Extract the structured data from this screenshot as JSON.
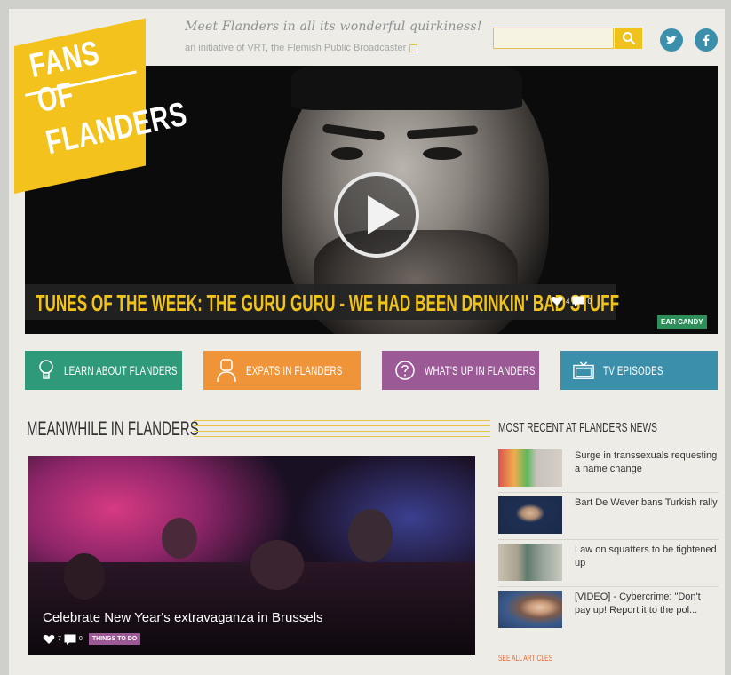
{
  "header": {
    "tagline": "Meet Flanders in all its wonderful quirkiness!",
    "subtagline": "an initiative of VRT, the Flemish Public Broadcaster",
    "search_placeholder": "",
    "social": [
      "twitter-icon",
      "facebook-icon"
    ]
  },
  "logo": {
    "line1": "FANS OF",
    "line2": "FLANDERS"
  },
  "hero": {
    "title": "TUNES OF THE WEEK: THE GURU GURU - WE HAD BEEN DRINKIN' BAD STUFF",
    "likes": "4",
    "comments": "0",
    "tag": "EAR CANDY"
  },
  "categories": [
    {
      "label": "LEARN ABOUT FLANDERS",
      "color": "#2e9a7a",
      "icon": "lightbulb-icon"
    },
    {
      "label": "EXPATS IN FLANDERS",
      "color": "#f0943a",
      "icon": "person-icon"
    },
    {
      "label": "WHAT'S UP IN FLANDERS",
      "color": "#9b5a96",
      "icon": "question-icon"
    },
    {
      "label": "TV EPISODES",
      "color": "#3b8faa",
      "icon": "tv-icon"
    }
  ],
  "meanwhile": {
    "title": "MEANWHILE IN FLANDERS",
    "caption": "Celebrate New Year's extravaganza in Brussels",
    "likes": "7",
    "comments": "0",
    "tag": "THINGS TO DO"
  },
  "news": {
    "title": "MOST RECENT AT FLANDERS NEWS",
    "items": [
      {
        "text": "Surge in transsexuals requesting a name change"
      },
      {
        "text": "Bart De Wever bans Turkish rally"
      },
      {
        "text": "Law on squatters to be tightened up"
      },
      {
        "text": "[VIDEO] - Cybercrime: \"Don't pay up! Report it to the pol..."
      }
    ],
    "see_all": "SEE ALL ARTICLES"
  },
  "colors": {
    "brand_yellow": "#f3c21c",
    "background": "#eeece7"
  }
}
